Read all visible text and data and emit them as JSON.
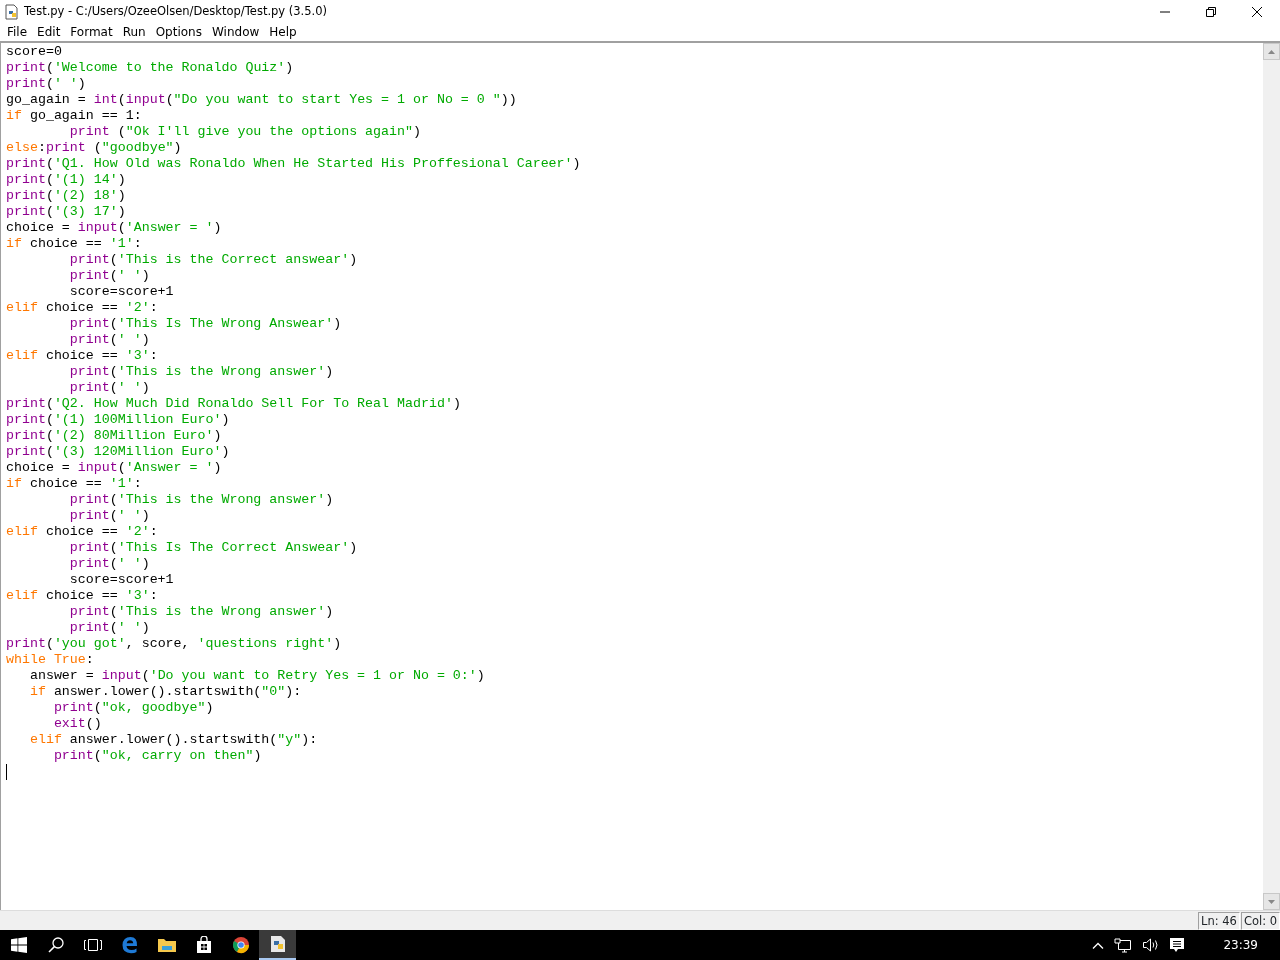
{
  "window": {
    "title": "Test.py - C:/Users/OzeeOlsen/Desktop/Test.py (3.5.0)"
  },
  "menu": [
    "File",
    "Edit",
    "Format",
    "Run",
    "Options",
    "Window",
    "Help"
  ],
  "code_lines": [
    [
      {
        "kind": "plain",
        "text": "score=0"
      }
    ],
    [
      {
        "kind": "builtin",
        "text": "print"
      },
      {
        "kind": "plain",
        "text": "("
      },
      {
        "kind": "string",
        "text": "'Welcome to the Ronaldo Quiz'"
      },
      {
        "kind": "plain",
        "text": ")"
      }
    ],
    [
      {
        "kind": "builtin",
        "text": "print"
      },
      {
        "kind": "plain",
        "text": "("
      },
      {
        "kind": "string",
        "text": "' '"
      },
      {
        "kind": "plain",
        "text": ")"
      }
    ],
    [
      {
        "kind": "plain",
        "text": "go_again = "
      },
      {
        "kind": "builtin",
        "text": "int"
      },
      {
        "kind": "plain",
        "text": "("
      },
      {
        "kind": "builtin",
        "text": "input"
      },
      {
        "kind": "plain",
        "text": "("
      },
      {
        "kind": "string",
        "text": "\"Do you want to start Yes = 1 or No = 0 \""
      },
      {
        "kind": "plain",
        "text": "))"
      }
    ],
    [
      {
        "kind": "keyword",
        "text": "if"
      },
      {
        "kind": "plain",
        "text": " go_again == 1:"
      }
    ],
    [
      {
        "kind": "builtin",
        "text": "        print"
      },
      {
        "kind": "plain",
        "text": " ("
      },
      {
        "kind": "string",
        "text": "\"Ok I'll give you the options again\""
      },
      {
        "kind": "plain",
        "text": ")"
      }
    ],
    [
      {
        "kind": "keyword",
        "text": "else"
      },
      {
        "kind": "plain",
        "text": ":"
      },
      {
        "kind": "builtin",
        "text": "print"
      },
      {
        "kind": "plain",
        "text": " ("
      },
      {
        "kind": "string",
        "text": "\"goodbye\""
      },
      {
        "kind": "plain",
        "text": ")"
      }
    ],
    [
      {
        "kind": "builtin",
        "text": "print"
      },
      {
        "kind": "plain",
        "text": "("
      },
      {
        "kind": "string",
        "text": "'Q1. How Old was Ronaldo When He Started His Proffesional Career'"
      },
      {
        "kind": "plain",
        "text": ")"
      }
    ],
    [
      {
        "kind": "builtin",
        "text": "print"
      },
      {
        "kind": "plain",
        "text": "("
      },
      {
        "kind": "string",
        "text": "'(1) 14'"
      },
      {
        "kind": "plain",
        "text": ")"
      }
    ],
    [
      {
        "kind": "builtin",
        "text": "print"
      },
      {
        "kind": "plain",
        "text": "("
      },
      {
        "kind": "string",
        "text": "'(2) 18'"
      },
      {
        "kind": "plain",
        "text": ")"
      }
    ],
    [
      {
        "kind": "builtin",
        "text": "print"
      },
      {
        "kind": "plain",
        "text": "("
      },
      {
        "kind": "string",
        "text": "'(3) 17'"
      },
      {
        "kind": "plain",
        "text": ")"
      }
    ],
    [
      {
        "kind": "plain",
        "text": "choice = "
      },
      {
        "kind": "builtin",
        "text": "input"
      },
      {
        "kind": "plain",
        "text": "("
      },
      {
        "kind": "string",
        "text": "'Answer = '"
      },
      {
        "kind": "plain",
        "text": ")"
      }
    ],
    [
      {
        "kind": "keyword",
        "text": "if"
      },
      {
        "kind": "plain",
        "text": " choice == "
      },
      {
        "kind": "string",
        "text": "'1'"
      },
      {
        "kind": "plain",
        "text": ":"
      }
    ],
    [
      {
        "kind": "builtin",
        "text": "        print"
      },
      {
        "kind": "plain",
        "text": "("
      },
      {
        "kind": "string",
        "text": "'This is the Correct answear'"
      },
      {
        "kind": "plain",
        "text": ")"
      }
    ],
    [
      {
        "kind": "builtin",
        "text": "        print"
      },
      {
        "kind": "plain",
        "text": "("
      },
      {
        "kind": "string",
        "text": "' '"
      },
      {
        "kind": "plain",
        "text": ")"
      }
    ],
    [
      {
        "kind": "plain",
        "text": "        score=score+1"
      }
    ],
    [
      {
        "kind": "keyword",
        "text": "elif"
      },
      {
        "kind": "plain",
        "text": " choice == "
      },
      {
        "kind": "string",
        "text": "'2'"
      },
      {
        "kind": "plain",
        "text": ":"
      }
    ],
    [
      {
        "kind": "builtin",
        "text": "        print"
      },
      {
        "kind": "plain",
        "text": "("
      },
      {
        "kind": "string",
        "text": "'This Is The Wrong Answear'"
      },
      {
        "kind": "plain",
        "text": ")"
      }
    ],
    [
      {
        "kind": "builtin",
        "text": "        print"
      },
      {
        "kind": "plain",
        "text": "("
      },
      {
        "kind": "string",
        "text": "' '"
      },
      {
        "kind": "plain",
        "text": ")"
      }
    ],
    [
      {
        "kind": "keyword",
        "text": "elif"
      },
      {
        "kind": "plain",
        "text": " choice == "
      },
      {
        "kind": "string",
        "text": "'3'"
      },
      {
        "kind": "plain",
        "text": ":"
      }
    ],
    [
      {
        "kind": "builtin",
        "text": "        print"
      },
      {
        "kind": "plain",
        "text": "("
      },
      {
        "kind": "string",
        "text": "'This is the Wrong answer'"
      },
      {
        "kind": "plain",
        "text": ")"
      }
    ],
    [
      {
        "kind": "builtin",
        "text": "        print"
      },
      {
        "kind": "plain",
        "text": "("
      },
      {
        "kind": "string",
        "text": "' '"
      },
      {
        "kind": "plain",
        "text": ")"
      }
    ],
    [
      {
        "kind": "builtin",
        "text": "print"
      },
      {
        "kind": "plain",
        "text": "("
      },
      {
        "kind": "string",
        "text": "'Q2. How Much Did Ronaldo Sell For To Real Madrid'"
      },
      {
        "kind": "plain",
        "text": ")"
      }
    ],
    [
      {
        "kind": "builtin",
        "text": "print"
      },
      {
        "kind": "plain",
        "text": "("
      },
      {
        "kind": "string",
        "text": "'(1) 100Million Euro'"
      },
      {
        "kind": "plain",
        "text": ")"
      }
    ],
    [
      {
        "kind": "builtin",
        "text": "print"
      },
      {
        "kind": "plain",
        "text": "("
      },
      {
        "kind": "string",
        "text": "'(2) 80Million Euro'"
      },
      {
        "kind": "plain",
        "text": ")"
      }
    ],
    [
      {
        "kind": "builtin",
        "text": "print"
      },
      {
        "kind": "plain",
        "text": "("
      },
      {
        "kind": "string",
        "text": "'(3) 120Million Euro'"
      },
      {
        "kind": "plain",
        "text": ")"
      }
    ],
    [
      {
        "kind": "plain",
        "text": "choice = "
      },
      {
        "kind": "builtin",
        "text": "input"
      },
      {
        "kind": "plain",
        "text": "("
      },
      {
        "kind": "string",
        "text": "'Answer = '"
      },
      {
        "kind": "plain",
        "text": ")"
      }
    ],
    [
      {
        "kind": "keyword",
        "text": "if"
      },
      {
        "kind": "plain",
        "text": " choice == "
      },
      {
        "kind": "string",
        "text": "'1'"
      },
      {
        "kind": "plain",
        "text": ":"
      }
    ],
    [
      {
        "kind": "builtin",
        "text": "        print"
      },
      {
        "kind": "plain",
        "text": "("
      },
      {
        "kind": "string",
        "text": "'This is the Wrong answer'"
      },
      {
        "kind": "plain",
        "text": ")"
      }
    ],
    [
      {
        "kind": "builtin",
        "text": "        print"
      },
      {
        "kind": "plain",
        "text": "("
      },
      {
        "kind": "string",
        "text": "' '"
      },
      {
        "kind": "plain",
        "text": ")"
      }
    ],
    [
      {
        "kind": "keyword",
        "text": "elif"
      },
      {
        "kind": "plain",
        "text": " choice == "
      },
      {
        "kind": "string",
        "text": "'2'"
      },
      {
        "kind": "plain",
        "text": ":"
      }
    ],
    [
      {
        "kind": "builtin",
        "text": "        print"
      },
      {
        "kind": "plain",
        "text": "("
      },
      {
        "kind": "string",
        "text": "'This Is The Correct Answear'"
      },
      {
        "kind": "plain",
        "text": ")"
      }
    ],
    [
      {
        "kind": "builtin",
        "text": "        print"
      },
      {
        "kind": "plain",
        "text": "("
      },
      {
        "kind": "string",
        "text": "' '"
      },
      {
        "kind": "plain",
        "text": ")"
      }
    ],
    [
      {
        "kind": "plain",
        "text": "        score=score+1"
      }
    ],
    [
      {
        "kind": "keyword",
        "text": "elif"
      },
      {
        "kind": "plain",
        "text": " choice == "
      },
      {
        "kind": "string",
        "text": "'3'"
      },
      {
        "kind": "plain",
        "text": ":"
      }
    ],
    [
      {
        "kind": "builtin",
        "text": "        print"
      },
      {
        "kind": "plain",
        "text": "("
      },
      {
        "kind": "string",
        "text": "'This is the Wrong answer'"
      },
      {
        "kind": "plain",
        "text": ")"
      }
    ],
    [
      {
        "kind": "builtin",
        "text": "        print"
      },
      {
        "kind": "plain",
        "text": "("
      },
      {
        "kind": "string",
        "text": "' '"
      },
      {
        "kind": "plain",
        "text": ")"
      }
    ],
    [
      {
        "kind": "builtin",
        "text": "print"
      },
      {
        "kind": "plain",
        "text": "("
      },
      {
        "kind": "string",
        "text": "'you got'"
      },
      {
        "kind": "plain",
        "text": ", score, "
      },
      {
        "kind": "string",
        "text": "'questions right'"
      },
      {
        "kind": "plain",
        "text": ")"
      }
    ],
    [
      {
        "kind": "keyword",
        "text": "while True"
      },
      {
        "kind": "plain",
        "text": ":"
      }
    ],
    [
      {
        "kind": "plain",
        "text": "   answer = "
      },
      {
        "kind": "builtin",
        "text": "input"
      },
      {
        "kind": "plain",
        "text": "("
      },
      {
        "kind": "string",
        "text": "'Do you want to Retry Yes = 1 or No = 0:'"
      },
      {
        "kind": "plain",
        "text": ")"
      }
    ],
    [
      {
        "kind": "keyword",
        "text": "   if"
      },
      {
        "kind": "plain",
        "text": " answer.lower().startswith("
      },
      {
        "kind": "string",
        "text": "\"0\""
      },
      {
        "kind": "plain",
        "text": "):"
      }
    ],
    [
      {
        "kind": "builtin",
        "text": "      print"
      },
      {
        "kind": "plain",
        "text": "("
      },
      {
        "kind": "string",
        "text": "\"ok, goodbye\""
      },
      {
        "kind": "plain",
        "text": ")"
      }
    ],
    [
      {
        "kind": "builtin",
        "text": "      exit"
      },
      {
        "kind": "plain",
        "text": "()"
      }
    ],
    [
      {
        "kind": "keyword",
        "text": "   elif"
      },
      {
        "kind": "plain",
        "text": " answer.lower().startswith("
      },
      {
        "kind": "string",
        "text": "\"y\""
      },
      {
        "kind": "plain",
        "text": "):"
      }
    ],
    [
      {
        "kind": "builtin",
        "text": "      print"
      },
      {
        "kind": "plain",
        "text": "("
      },
      {
        "kind": "string",
        "text": "\"ok, carry on then\""
      },
      {
        "kind": "plain",
        "text": ")"
      }
    ]
  ],
  "status_bar": {
    "line": "Ln: 46",
    "column": "Col: 0"
  },
  "taskbar": {
    "apps": [
      {
        "kind": "start",
        "selected": false
      },
      {
        "kind": "search",
        "selected": false
      },
      {
        "kind": "taskview",
        "selected": false
      },
      {
        "kind": "edge",
        "selected": false
      },
      {
        "kind": "folder",
        "selected": false
      },
      {
        "kind": "store",
        "selected": false
      },
      {
        "kind": "chrome",
        "selected": false
      },
      {
        "kind": "idle",
        "selected": true
      }
    ],
    "clock": "23:39"
  }
}
